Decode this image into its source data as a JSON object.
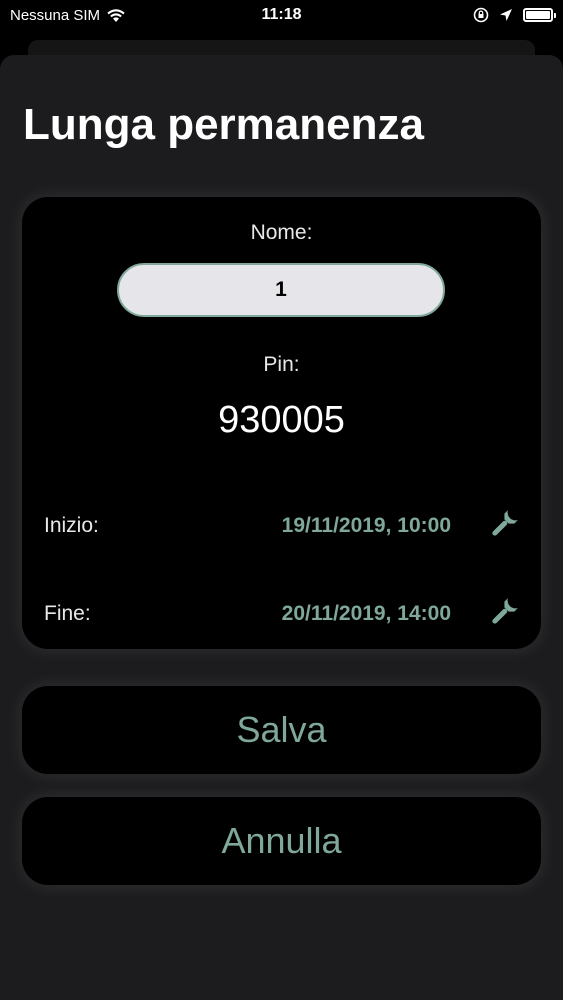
{
  "status": {
    "carrier": "Nessuna SIM",
    "time": "11:18"
  },
  "page": {
    "title": "Lunga permanenza"
  },
  "form": {
    "name_label": "Nome:",
    "name_value": "1",
    "pin_label": "Pin:",
    "pin_value": "930005",
    "start_label": "Inizio:",
    "start_value": "19/11/2019, 10:00",
    "end_label": "Fine:",
    "end_value": "20/11/2019, 14:00",
    "edit_icon": "wrench-icon"
  },
  "actions": {
    "save_label": "Salva",
    "cancel_label": "Annulla"
  },
  "colors": {
    "accent": "#7fa89a",
    "background": "#1c1c1e",
    "card": "#000000",
    "input": "#e5e5ea"
  }
}
